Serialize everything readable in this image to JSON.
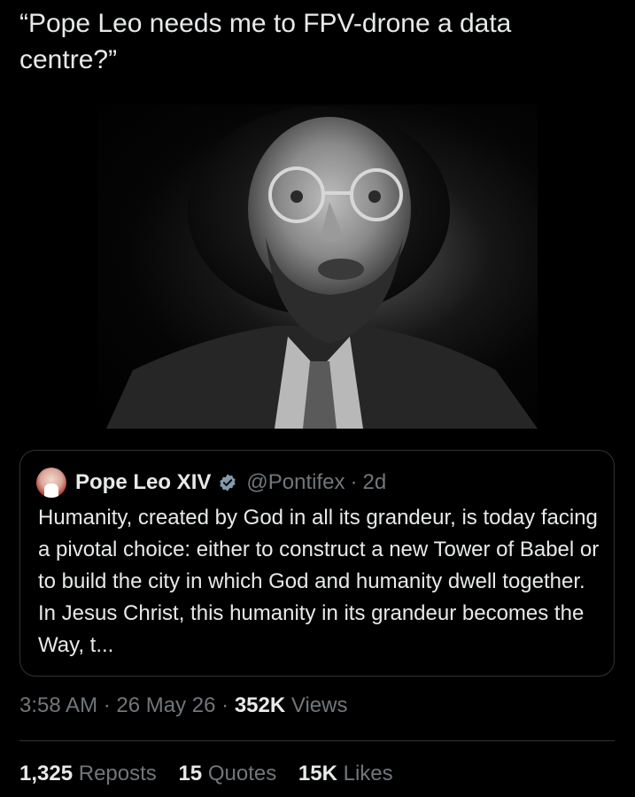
{
  "post": {
    "text": "“Pope Leo needs me to FPV-drone a data centre?”",
    "timestamp": "3:58 AM",
    "date": "26 May 26",
    "views_count": "352K",
    "views_label": "Views",
    "separator": "·"
  },
  "media": {
    "type": "photo",
    "description_icon": "portrait-image"
  },
  "quoted_post": {
    "author_name": "Pope Leo XIV",
    "handle": "@Pontifex",
    "age": "2d",
    "verified_icon": "verified-badge-icon",
    "text": "Humanity, created by God in all its grandeur, is today facing a pivotal choice: either to construct a new Tower of Babel or to build the city in which God and humanity dwell together. In Jesus Christ, this humanity in its grandeur becomes the Way, t...",
    "separator": "·"
  },
  "stats": {
    "reposts_count": "1,325",
    "reposts_label": "Reposts",
    "quotes_count": "15",
    "quotes_label": "Quotes",
    "likes_count": "15K",
    "likes_label": "Likes"
  },
  "colors": {
    "background": "#000000",
    "text_primary": "#e7e9ea",
    "text_secondary": "#71767b",
    "border": "#2f3336",
    "verified": "#829aab"
  }
}
